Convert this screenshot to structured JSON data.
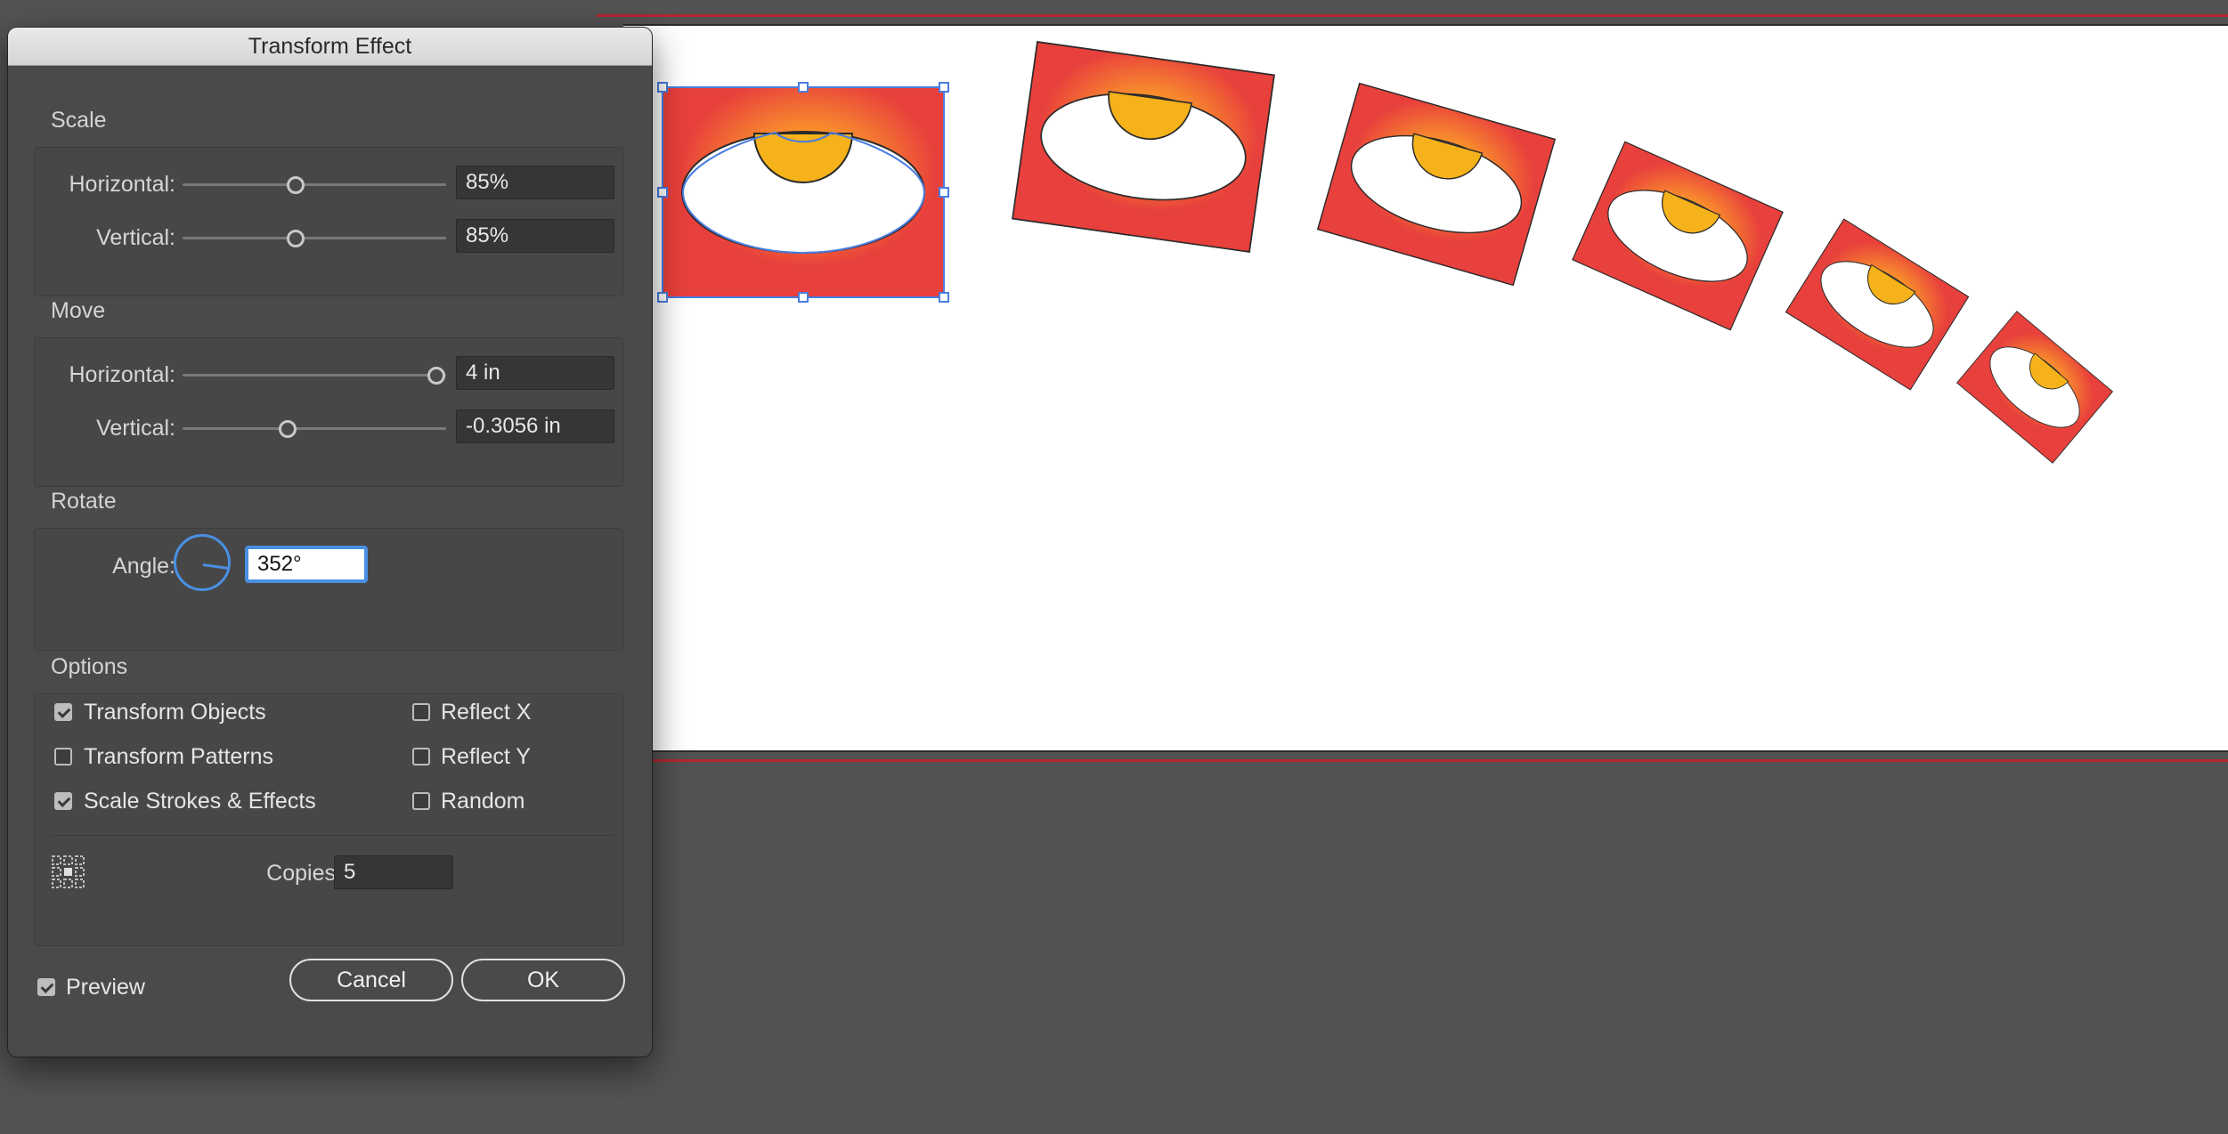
{
  "dialog": {
    "title": "Transform Effect",
    "scale": {
      "title": "Scale",
      "horizontal_label": "Horizontal:",
      "horizontal_value": "85%",
      "vertical_label": "Vertical:",
      "vertical_value": "85%"
    },
    "move": {
      "title": "Move",
      "horizontal_label": "Horizontal:",
      "horizontal_value": "4 in",
      "vertical_label": "Vertical:",
      "vertical_value": "-0.3056 in"
    },
    "rotate": {
      "title": "Rotate",
      "angle_label": "Angle:",
      "angle_value": "352°"
    },
    "options": {
      "title": "Options",
      "transform_objects": "Transform Objects",
      "transform_patterns": "Transform Patterns",
      "scale_strokes_effects": "Scale Strokes & Effects",
      "reflect_x": "Reflect X",
      "reflect_y": "Reflect Y",
      "random": "Random",
      "copies_label": "Copies",
      "copies_value": "5"
    },
    "preview_label": "Preview",
    "cancel_label": "Cancel",
    "ok_label": "OK"
  },
  "checkbox_states": {
    "transform_objects": true,
    "transform_patterns": false,
    "scale_strokes_effects": true,
    "reflect_x": false,
    "reflect_y": false,
    "random": false,
    "preview": true
  },
  "colors": {
    "accent": "#4a90e2",
    "artwork_red": "#e8403c",
    "artwork_yellow": "#ffc21a",
    "bleed_guide": "#b3262e"
  },
  "icons": {
    "reference_point": "reference-point-grid-icon",
    "angle": "angle-dial-icon"
  }
}
